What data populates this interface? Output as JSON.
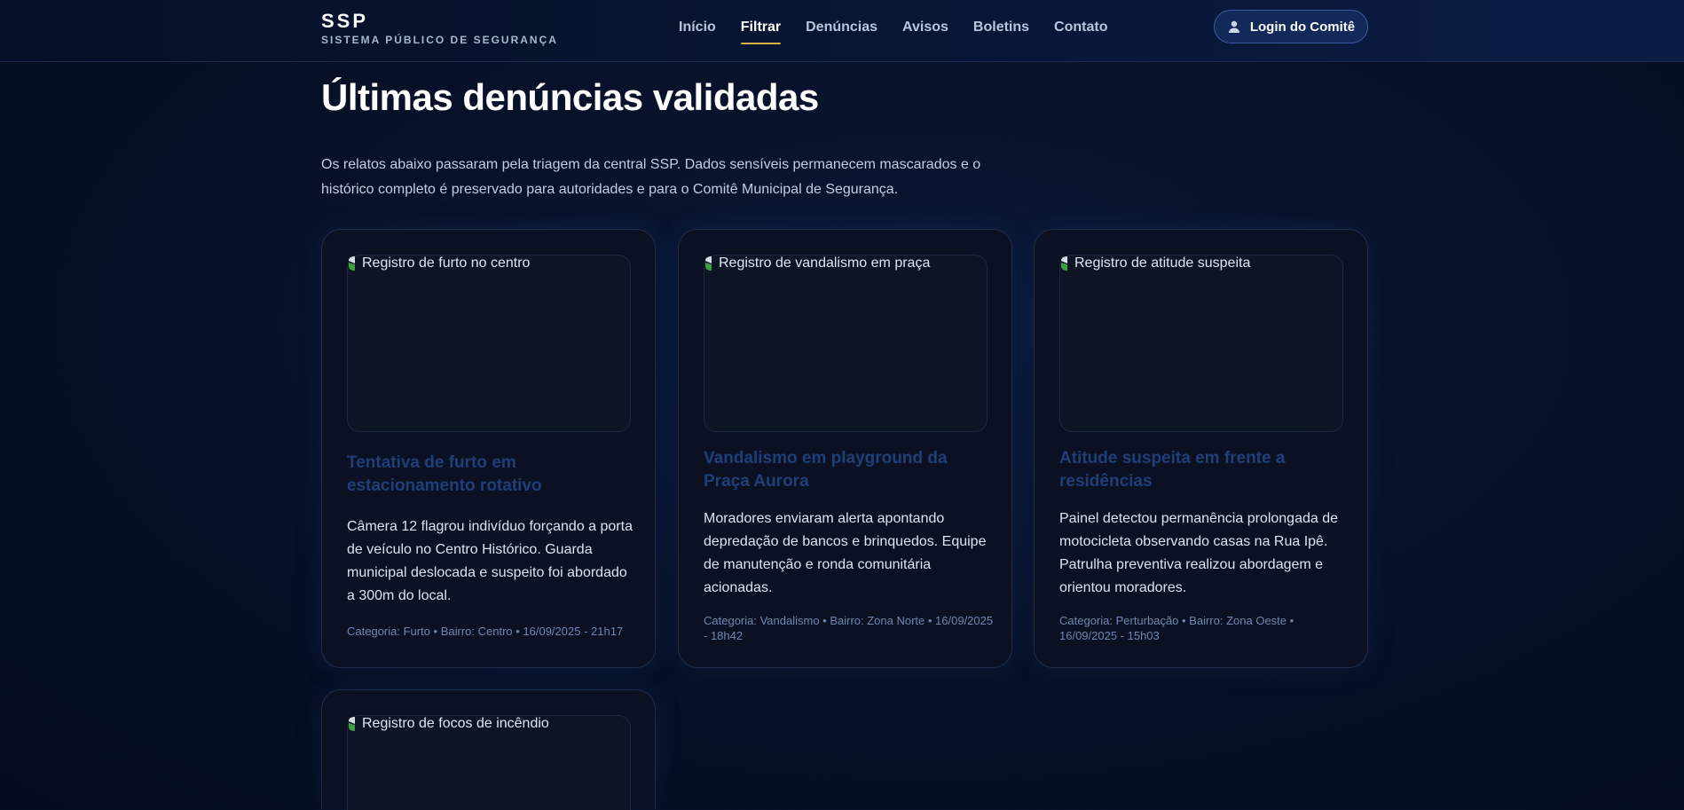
{
  "brand": {
    "title": "SSP",
    "subtitle": "SISTEMA PÚBLICO DE SEGURANÇA"
  },
  "nav": {
    "items": [
      {
        "label": "Início"
      },
      {
        "label": "Filtrar",
        "active": true
      },
      {
        "label": "Denúncias"
      },
      {
        "label": "Avisos"
      },
      {
        "label": "Boletins"
      },
      {
        "label": "Contato"
      }
    ],
    "login_label": "Login do Comitê",
    "login_icon": "user-icon"
  },
  "page": {
    "title": "Últimas denúncias validadas",
    "intro": "Os relatos abaixo passaram pela triagem da central SSP. Dados sensíveis permanecem mascarados e o histórico completo é preservado para autoridades e para o Comitê Municipal de Segurança."
  },
  "cards": [
    {
      "image_alt": "Registro de furto no centro",
      "title": "Tentativa de furto em estacionamento rotativo",
      "description": "Câmera 12 flagrou indivíduo forçando a porta de veículo no Centro Histórico. Guarda municipal deslocada e suspeito foi abordado a 300m do local.",
      "meta": "Categoria: Furto • Bairro: Centro • 16/09/2025 - 21h17"
    },
    {
      "image_alt": "Registro de vandalismo em praça",
      "title": "Vandalismo em playground da Praça Aurora",
      "description": "Moradores enviaram alerta apontando depredação de bancos e brinquedos. Equipe de manutenção e ronda comunitária acionadas.",
      "meta": "Categoria: Vandalismo • Bairro: Zona Norte • 16/09/2025 - 18h42"
    },
    {
      "image_alt": "Registro de atitude suspeita",
      "title": "Atitude suspeita em frente a residências",
      "description": "Painel detectou permanência prolongada de motocicleta observando casas na Rua Ipê. Patrulha preventiva realizou abordagem e orientou moradores.",
      "meta": "Categoria: Perturbação • Bairro: Zona Oeste • 16/09/2025 - 15h03"
    },
    {
      "image_alt": "Registro de focos de incêndio"
    }
  ],
  "colors": {
    "background": "#071129",
    "accent_underline": "#d9b24b",
    "card_title": "#1e3f78",
    "meta_text": "#6d86b3"
  }
}
